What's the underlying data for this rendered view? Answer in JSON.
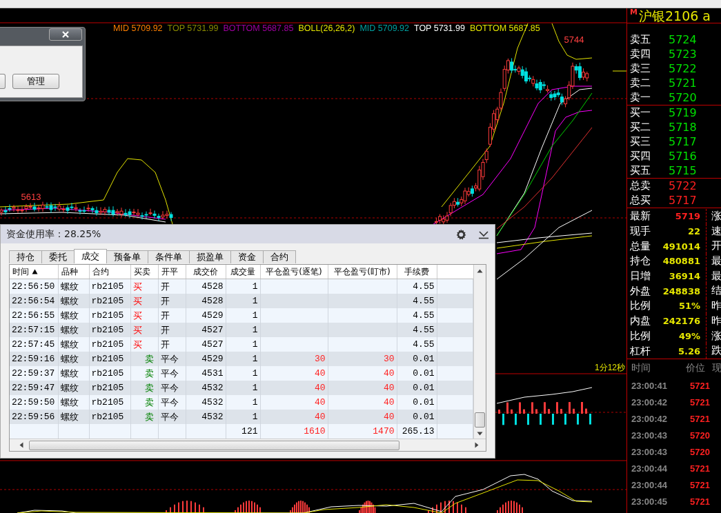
{
  "chart": {
    "legend": [
      {
        "text": "MID 5709.92",
        "color": "#ff7f00"
      },
      {
        "text": "TOP 5731.99",
        "color": "#8a8a00"
      },
      {
        "text": "BOTTOM 5687.85",
        "color": "#a000a0"
      },
      {
        "text": "BOLL(26,26,2)",
        "color": "#e6e600"
      },
      {
        "text": "MID 5709.92",
        "color": "#00a0a0"
      },
      {
        "text": "TOP 5731.99",
        "color": "#ffffff"
      },
      {
        "text": "BOTTOM 5687.85",
        "color": "#e6e600"
      }
    ],
    "high_label": "5744",
    "low_label": "5613",
    "timer": "1分12秒"
  },
  "manage_dialog": {
    "button": "管理"
  },
  "trade_panel": {
    "title": "资金使用率：28.25%",
    "tabs": [
      {
        "label": "持仓",
        "selected": false
      },
      {
        "label": "委托",
        "selected": false
      },
      {
        "label": "成交",
        "selected": true
      },
      {
        "label": "预备单",
        "selected": false
      },
      {
        "label": "条件单",
        "selected": false
      },
      {
        "label": "损盈单",
        "selected": false
      },
      {
        "label": "资金",
        "selected": false
      },
      {
        "label": "合约",
        "selected": false
      }
    ],
    "columns": [
      {
        "label": "时间",
        "sorted": true
      },
      {
        "label": "品种",
        "sorted": false
      },
      {
        "label": "合约",
        "sorted": false
      },
      {
        "label": "买卖",
        "sorted": false
      },
      {
        "label": "开平",
        "sorted": false
      },
      {
        "label": "成交价",
        "sorted": false
      },
      {
        "label": "成交量",
        "sorted": false
      },
      {
        "label": "平仓盈亏(逐笔)",
        "sorted": false
      },
      {
        "label": "平仓盈亏(盯市)",
        "sorted": false
      },
      {
        "label": "手续费",
        "sorted": false
      }
    ],
    "rows": [
      {
        "time": "22:56:50",
        "product": "螺纹",
        "contract": "rb2105",
        "side": "买",
        "kind": "buy",
        "offset": "开",
        "price": "4528",
        "qty": "1",
        "fee": "4.55"
      },
      {
        "time": "22:56:54",
        "product": "螺纹",
        "contract": "rb2105",
        "side": "买",
        "kind": "buy",
        "offset": "开",
        "price": "4528",
        "qty": "1",
        "fee": "4.55"
      },
      {
        "time": "22:56:55",
        "product": "螺纹",
        "contract": "rb2105",
        "side": "买",
        "kind": "buy",
        "offset": "开",
        "price": "4529",
        "qty": "1",
        "fee": "4.55"
      },
      {
        "time": "22:57:15",
        "product": "螺纹",
        "contract": "rb2105",
        "side": "买",
        "kind": "buy",
        "offset": "开",
        "price": "4527",
        "qty": "1",
        "fee": "4.55"
      },
      {
        "time": "22:57:45",
        "product": "螺纹",
        "contract": "rb2105",
        "side": "买",
        "kind": "buy",
        "offset": "开",
        "price": "4527",
        "qty": "1",
        "fee": "4.55"
      },
      {
        "time": "22:59:16",
        "product": "螺纹",
        "contract": "rb2105",
        "side": "卖",
        "kind": "sell",
        "offset": "平今",
        "price": "4529",
        "qty": "1",
        "pnl_trade": "30",
        "pnl_mark": "30",
        "fee": "0.01"
      },
      {
        "time": "22:59:37",
        "product": "螺纹",
        "contract": "rb2105",
        "side": "卖",
        "kind": "sell",
        "offset": "平今",
        "price": "4531",
        "qty": "1",
        "pnl_trade": "40",
        "pnl_mark": "40",
        "fee": "0.01"
      },
      {
        "time": "22:59:47",
        "product": "螺纹",
        "contract": "rb2105",
        "side": "卖",
        "kind": "sell",
        "offset": "平今",
        "price": "4532",
        "qty": "1",
        "pnl_trade": "40",
        "pnl_mark": "40",
        "fee": "0.01"
      },
      {
        "time": "22:59:50",
        "product": "螺纹",
        "contract": "rb2105",
        "side": "卖",
        "kind": "sell",
        "offset": "平今",
        "price": "4532",
        "qty": "1",
        "pnl_trade": "40",
        "pnl_mark": "40",
        "fee": "0.01"
      },
      {
        "time": "22:59:56",
        "product": "螺纹",
        "contract": "rb2105",
        "side": "卖",
        "kind": "sell",
        "offset": "平今",
        "price": "4532",
        "qty": "1",
        "pnl_trade": "40",
        "pnl_mark": "40",
        "fee": "0.01"
      }
    ],
    "totals": {
      "qty": "121",
      "pnl_trade": "1610",
      "pnl_mark": "1470",
      "fee": "265.13"
    }
  },
  "quote": {
    "badge": "M",
    "title": "沪银2106 a",
    "asks": [
      {
        "label": "卖五",
        "price": "5724"
      },
      {
        "label": "卖四",
        "price": "5723"
      },
      {
        "label": "卖三",
        "price": "5722"
      },
      {
        "label": "卖二",
        "price": "5721"
      },
      {
        "label": "卖一",
        "price": "5720"
      }
    ],
    "bids": [
      {
        "label": "买一",
        "price": "5719"
      },
      {
        "label": "买二",
        "price": "5718"
      },
      {
        "label": "买三",
        "price": "5717"
      },
      {
        "label": "买四",
        "price": "5716"
      },
      {
        "label": "买五",
        "price": "5715"
      }
    ],
    "totals": [
      {
        "label": "总卖",
        "price": "5722"
      },
      {
        "label": "总买",
        "price": "5717"
      }
    ],
    "stats": [
      {
        "label": "最新",
        "value": "5719",
        "kind": "price",
        "side_label": "涨"
      },
      {
        "label": "现手",
        "value": "22",
        "kind": "stat",
        "side_label": "速"
      },
      {
        "label": "总量",
        "value": "491014",
        "kind": "stat",
        "side_label": "开"
      },
      {
        "label": "持仓",
        "value": "480881",
        "kind": "stat",
        "side_label": "最"
      },
      {
        "label": "日增",
        "value": "36914",
        "kind": "stat",
        "side_label": "最"
      },
      {
        "label": "外盘",
        "value": "248838",
        "kind": "stat",
        "side_label": "结"
      },
      {
        "label": "比例",
        "value": "51%",
        "kind": "stat",
        "side_label": "昨"
      },
      {
        "label": "内盘",
        "value": "242176",
        "kind": "stat",
        "side_label": "昨"
      },
      {
        "label": "比例",
        "value": "49%",
        "kind": "stat",
        "side_label": "涨"
      },
      {
        "label": "杠杆",
        "value": "5.26",
        "kind": "stat",
        "side_label": "跌"
      }
    ],
    "ticks": {
      "columns": [
        "时间",
        "价位",
        "现"
      ],
      "rows": [
        {
          "time": "23:00:41",
          "price": "5721"
        },
        {
          "time": "23:00:42",
          "price": "5721"
        },
        {
          "time": "23:00:42",
          "price": "5721"
        },
        {
          "time": "23:00:43",
          "price": "5720"
        },
        {
          "time": "23:00:43",
          "price": "5720"
        },
        {
          "time": "23:00:44",
          "price": "5721"
        },
        {
          "time": "23:00:44",
          "price": "5721"
        },
        {
          "time": "23:00:45",
          "price": "5721"
        }
      ]
    }
  }
}
